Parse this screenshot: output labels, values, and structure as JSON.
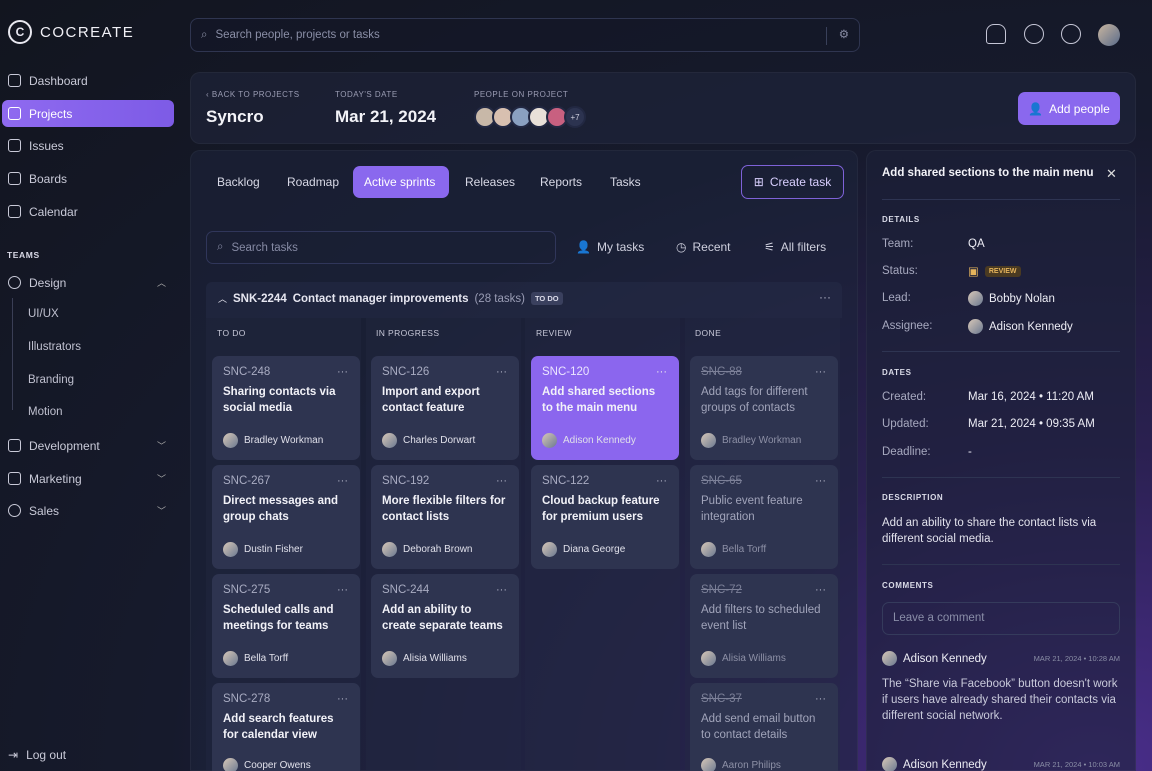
{
  "app": {
    "name": "COCREATE"
  },
  "sidebar": {
    "items": [
      {
        "label": "Dashboard"
      },
      {
        "label": "Projects"
      },
      {
        "label": "Issues"
      },
      {
        "label": "Boards"
      },
      {
        "label": "Calendar"
      }
    ],
    "teams_label": "TEAMS",
    "teams": [
      {
        "label": "Design",
        "subitems": [
          "UI/UX",
          "Illustrators",
          "Branding",
          "Motion"
        ]
      },
      {
        "label": "Development"
      },
      {
        "label": "Marketing"
      },
      {
        "label": "Sales"
      }
    ],
    "logout": "Log out"
  },
  "search": {
    "placeholder": "Search people, projects or tasks"
  },
  "header": {
    "back": "BACK TO PROJECTS",
    "project": "Syncro",
    "date_label": "TODAY'S DATE",
    "date": "Mar 21, 2024",
    "people_label": "PEOPLE ON PROJECT",
    "people_more": "+7",
    "add_people": "Add people"
  },
  "tabs": [
    "Backlog",
    "Roadmap",
    "Active sprints",
    "Releases",
    "Reports",
    "Tasks"
  ],
  "create_task": "Create task",
  "task_search": {
    "placeholder": "Search tasks"
  },
  "filters": {
    "my_tasks": "My tasks",
    "recent": "Recent",
    "all": "All filters"
  },
  "sprint": {
    "id": "SNK-2244",
    "name": "Contact manager improvements",
    "count": "(28 tasks)",
    "status": "TO DO"
  },
  "columns": [
    {
      "name": "TO DO",
      "cards": [
        {
          "id": "SNC-248",
          "title": "Sharing contacts via social media",
          "assignee": "Bradley Workman"
        },
        {
          "id": "SNC-267",
          "title": "Direct messages and group chats",
          "assignee": "Dustin Fisher"
        },
        {
          "id": "SNC-275",
          "title": "Scheduled calls and meetings for teams",
          "assignee": "Bella Torff"
        },
        {
          "id": "SNC-278",
          "title": "Add search features for calendar view",
          "assignee": "Cooper Owens"
        }
      ]
    },
    {
      "name": "IN PROGRESS",
      "cards": [
        {
          "id": "SNC-126",
          "title": "Import and export contact feature",
          "assignee": "Charles Dorwart"
        },
        {
          "id": "SNC-192",
          "title": "More flexible filters for contact lists",
          "assignee": "Deborah Brown"
        },
        {
          "id": "SNC-244",
          "title": "Add an ability to create separate teams",
          "assignee": "Alisia Williams"
        }
      ]
    },
    {
      "name": "REVIEW",
      "cards": [
        {
          "id": "SNC-120",
          "title": "Add shared sections to the main menu",
          "assignee": "Adison Kennedy"
        },
        {
          "id": "SNC-122",
          "title": "Cloud backup feature for premium users",
          "assignee": "Diana George"
        }
      ]
    },
    {
      "name": "DONE",
      "cards": [
        {
          "id": "SNC-88",
          "title": "Add tags for different groups of contacts",
          "assignee": "Bradley Workman"
        },
        {
          "id": "SNC-65",
          "title": "Public event feature integration",
          "assignee": "Bella Torff"
        },
        {
          "id": "SNC-72",
          "title": "Add filters to scheduled event list",
          "assignee": "Alisia Williams"
        },
        {
          "id": "SNC-37",
          "title": "Add send email button to contact details",
          "assignee": "Aaron Philips"
        }
      ]
    }
  ],
  "details": {
    "title": "Add shared sections to the main menu",
    "details_label": "DETAILS",
    "team_k": "Team:",
    "team_v": "QA",
    "status_k": "Status:",
    "status_v": "REVIEW",
    "lead_k": "Lead:",
    "lead_v": "Bobby Nolan",
    "assignee_k": "Assignee:",
    "assignee_v": "Adison Kennedy",
    "dates_label": "DATES",
    "created_k": "Created:",
    "created_v": "Mar 16, 2024 • 11:20 AM",
    "updated_k": "Updated:",
    "updated_v": "Mar 21, 2024 • 09:35 AM",
    "deadline_k": "Deadline:",
    "deadline_v": "-",
    "desc_label": "DESCRIPTION",
    "desc": "Add an ability to share the contact lists via different social media.",
    "comments_label": "COMMENTS",
    "comment_placeholder": "Leave a comment",
    "comments": [
      {
        "author": "Adison Kennedy",
        "date": "MAR 21, 2024 • 10:28 AM",
        "text": "The “Share via Facebook” button doesn't work if users have already shared their contacts via different social network."
      },
      {
        "author": "Adison Kennedy",
        "date": "MAR 21, 2024 • 10:03 AM"
      }
    ]
  }
}
